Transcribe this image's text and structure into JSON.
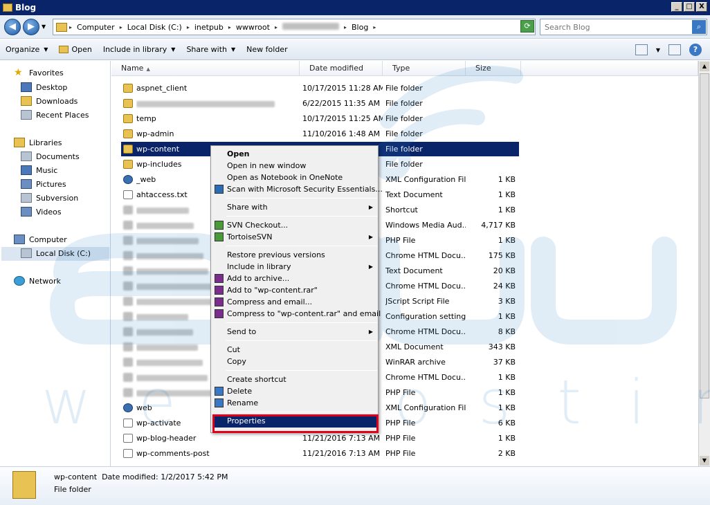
{
  "window": {
    "title": "Blog",
    "buttons": [
      "_",
      "□",
      "X"
    ]
  },
  "address": {
    "crumbs": [
      "Computer",
      "Local Disk (C:)",
      "inetpub",
      "wwwroot",
      "Blog"
    ],
    "search_placeholder": "Search Blog"
  },
  "toolbar": {
    "organize": "Organize",
    "open": "Open",
    "include": "Include in library",
    "share": "Share with",
    "new_folder": "New folder"
  },
  "nav": {
    "favorites": "Favorites",
    "desktop": "Desktop",
    "downloads": "Downloads",
    "recent": "Recent Places",
    "libraries": "Libraries",
    "documents": "Documents",
    "music": "Music",
    "pictures": "Pictures",
    "subversion": "Subversion",
    "videos": "Videos",
    "computer": "Computer",
    "local_disk": "Local Disk (C:)",
    "network": "Network"
  },
  "columns": {
    "name": "Name",
    "date": "Date modified",
    "type": "Type",
    "size": "Size"
  },
  "files": [
    {
      "name": "aspnet_client",
      "date": "10/17/2015 11:28 AM",
      "type": "File folder",
      "size": "",
      "icon": "folder"
    },
    {
      "name": "",
      "date": "6/22/2015 11:35 AM",
      "type": "File folder",
      "size": "",
      "icon": "folder"
    },
    {
      "name": "temp",
      "date": "10/17/2015 11:25 AM",
      "type": "File folder",
      "size": "",
      "icon": "folder"
    },
    {
      "name": "wp-admin",
      "date": "11/10/2016 1:48 AM",
      "type": "File folder",
      "size": "",
      "icon": "folder"
    },
    {
      "name": "wp-content",
      "date": "",
      "type": "File folder",
      "size": "",
      "icon": "folder"
    },
    {
      "name": "wp-includes",
      "date": "",
      "type": "File folder",
      "size": "",
      "icon": "folder"
    },
    {
      "name": "_web",
      "date": "",
      "type": "XML Configuration File",
      "size": "1 KB",
      "icon": "globe"
    },
    {
      "name": "ahtaccess.txt",
      "date": "",
      "type": "Text Document",
      "size": "1 KB",
      "icon": "page"
    },
    {
      "name": "",
      "date": "",
      "type": "Shortcut",
      "size": "1 KB",
      "icon": "blur"
    },
    {
      "name": "",
      "date": "",
      "type": "Windows Media Aud...",
      "size": "4,717 KB",
      "icon": "blur"
    },
    {
      "name": "",
      "date": "",
      "type": "PHP File",
      "size": "1 KB",
      "icon": "blur"
    },
    {
      "name": "",
      "date": "",
      "type": "Chrome HTML Docu...",
      "size": "175 KB",
      "icon": "blur"
    },
    {
      "name": "",
      "date": "",
      "type": "Text Document",
      "size": "20 KB",
      "icon": "blur"
    },
    {
      "name": "",
      "date": "",
      "type": "Chrome HTML Docu...",
      "size": "24 KB",
      "icon": "blur"
    },
    {
      "name": "",
      "date": "",
      "type": "JScript Script File",
      "size": "3 KB",
      "icon": "blur"
    },
    {
      "name": "",
      "date": "",
      "type": "Configuration settings",
      "size": "1 KB",
      "icon": "blur"
    },
    {
      "name": "",
      "date": "",
      "type": "Chrome HTML Docu...",
      "size": "8 KB",
      "icon": "blur"
    },
    {
      "name": "",
      "date": "",
      "type": "XML Document",
      "size": "343 KB",
      "icon": "blur"
    },
    {
      "name": "",
      "date": "",
      "type": "WinRAR archive",
      "size": "37 KB",
      "icon": "blur"
    },
    {
      "name": "",
      "date": "",
      "type": "Chrome HTML Docu...",
      "size": "1 KB",
      "icon": "blur"
    },
    {
      "name": "",
      "date": "",
      "type": "PHP File",
      "size": "1 KB",
      "icon": "blur"
    },
    {
      "name": "web",
      "date": "",
      "type": "XML Configuration File",
      "size": "1 KB",
      "icon": "globe"
    },
    {
      "name": "wp-activate",
      "date": "",
      "type": "PHP File",
      "size": "6 KB",
      "icon": "page"
    },
    {
      "name": "wp-blog-header",
      "date": "11/21/2016 7:13 AM",
      "type": "PHP File",
      "size": "1 KB",
      "icon": "page"
    },
    {
      "name": "wp-comments-post",
      "date": "11/21/2016 7:13 AM",
      "type": "PHP File",
      "size": "2 KB",
      "icon": "page"
    }
  ],
  "menu": [
    {
      "label": "Open",
      "bold": true
    },
    {
      "label": "Open in new window"
    },
    {
      "label": "Open as Notebook in OneNote"
    },
    {
      "label": "Scan with Microsoft Security Essentials...",
      "icon": "shield"
    },
    {
      "sep": true
    },
    {
      "label": "Share with",
      "sub": true
    },
    {
      "sep": true
    },
    {
      "label": "SVN Checkout...",
      "icon": "svn"
    },
    {
      "label": "TortoiseSVN",
      "sub": true,
      "icon": "svn"
    },
    {
      "sep": true
    },
    {
      "label": "Restore previous versions"
    },
    {
      "label": "Include in library",
      "sub": true
    },
    {
      "label": "Add to archive...",
      "icon": "rar"
    },
    {
      "label": "Add to \"wp-content.rar\"",
      "icon": "rar"
    },
    {
      "label": "Compress and email...",
      "icon": "rar"
    },
    {
      "label": "Compress to \"wp-content.rar\" and email",
      "icon": "rar"
    },
    {
      "sep": true
    },
    {
      "label": "Send to",
      "sub": true
    },
    {
      "sep": true
    },
    {
      "label": "Cut"
    },
    {
      "label": "Copy"
    },
    {
      "sep": true
    },
    {
      "label": "Create shortcut"
    },
    {
      "label": "Delete",
      "icon": "uac"
    },
    {
      "label": "Rename",
      "icon": "uac"
    },
    {
      "sep": true
    },
    {
      "label": "Properties",
      "highlight": true
    }
  ],
  "watermark": {
    "word": "w e b h o s t i n g"
  },
  "details": {
    "name": "wp-content",
    "date_label": "Date modified:",
    "date": "1/2/2017 5:42 PM",
    "type": "File folder"
  },
  "colors": {
    "selection": "#0a246a",
    "highlight_box": "#e2001a",
    "watermark": "#2a7fc4"
  }
}
